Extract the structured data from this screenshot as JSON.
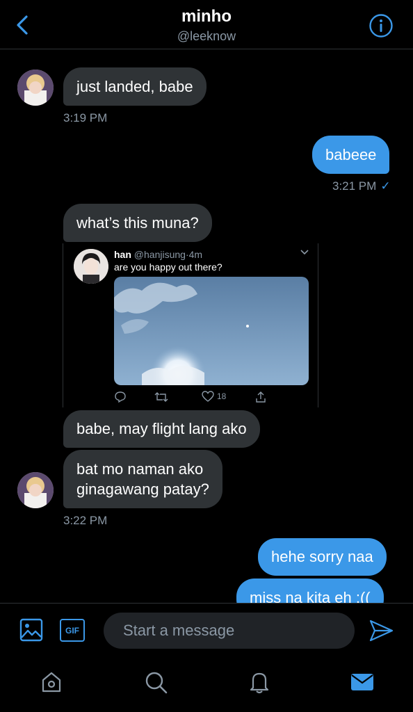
{
  "header": {
    "title": "minho",
    "handle": "@leeknow",
    "back_icon": "chevron-left-icon",
    "info_icon": "info-icon",
    "accent": "#3b98e8"
  },
  "messages": [
    {
      "id": "m1",
      "type": "received",
      "text": "just landed, babe"
    },
    {
      "id": "t1",
      "type": "timestamp",
      "text": "3:19 PM"
    },
    {
      "id": "m2",
      "type": "sent",
      "text": "babeee"
    },
    {
      "id": "t2",
      "type": "timestamp",
      "text": "3:21 PM"
    },
    {
      "id": "m3",
      "type": "received",
      "text": "what’s this muna?"
    },
    {
      "id": "m4",
      "type": "received",
      "text": "babe, may flight lang ako"
    },
    {
      "id": "m5",
      "type": "received",
      "line1": "bat mo naman ako",
      "line2": "ginagawang patay?"
    },
    {
      "id": "t3",
      "type": "timestamp",
      "text": "3:22 PM"
    },
    {
      "id": "m6",
      "type": "sent",
      "text": "hehe sorry naa"
    },
    {
      "id": "m7",
      "type": "sent",
      "text": "miss na kita eh :(("
    }
  ],
  "tweet": {
    "name": "han",
    "handle": "@hanjisung",
    "separator": "·",
    "age": "4m",
    "text": "are you happy out there?",
    "like_count": "18",
    "icons": [
      "reply-icon",
      "retweet-icon",
      "heart-icon",
      "share-icon"
    ]
  },
  "composer": {
    "placeholder": "Start a message",
    "gif_label": "GIF"
  },
  "nav": {
    "items": [
      "home-icon",
      "search-icon",
      "notifications-icon",
      "messages-icon"
    ],
    "active": "messages-icon"
  }
}
